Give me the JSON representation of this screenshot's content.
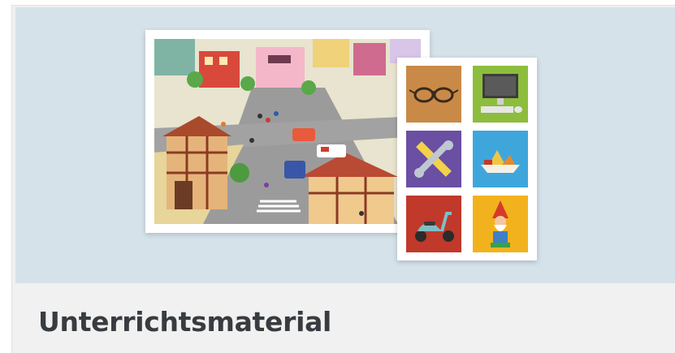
{
  "card": {
    "title": "Unterrichtsmaterial",
    "image_alt": "",
    "colors": {
      "media_background": "#d5e2ea",
      "footer_background": "#f1f1f1",
      "title_color": "#383c40"
    },
    "tiles": [
      {
        "icon": "glasses-icon",
        "color": "#c98a48"
      },
      {
        "icon": "computer-icon",
        "color": "#8dbd3c"
      },
      {
        "icon": "tools-icon",
        "color": "#6a4fa3"
      },
      {
        "icon": "boat-icon",
        "color": "#3fa6dc"
      },
      {
        "icon": "scooter-icon",
        "color": "#c0392b"
      },
      {
        "icon": "gnome-icon",
        "color": "#f2b21d"
      }
    ]
  }
}
